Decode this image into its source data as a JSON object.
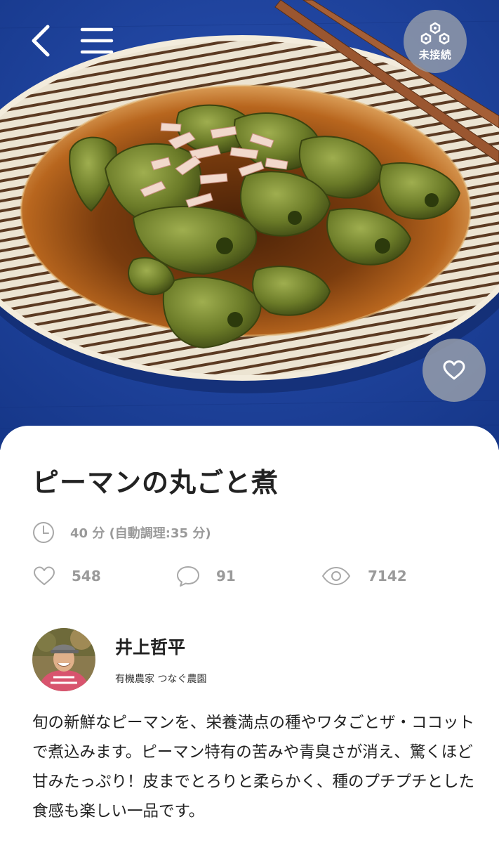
{
  "header": {
    "connect_label": "未接続",
    "icons": {
      "back": "chevron-left-icon",
      "menu": "hamburger-menu-icon",
      "connect": "hexagon-cluster-icon",
      "favorite": "heart-icon"
    }
  },
  "recipe": {
    "title": "ピーマンの丸ごと煮",
    "cook_time": "40 分 (自動調理:35 分)",
    "likes": "548",
    "comments": "91",
    "views": "7142",
    "description": "旬の新鮮なピーマンを、栄養満点の種やワタごとザ・ココットで煮込みます。ピーマン特有の苦みや青臭さが消え、驚くほど甘みたっぷり！皮までとろりと柔らかく、種のプチプチとした食感も楽しい一品です。"
  },
  "author": {
    "name": "井上哲平",
    "org": "有機農家 つなぐ農園"
  },
  "colors": {
    "tablecloth": "#1c3f9a",
    "plate": "#ece4d2",
    "broth": "#8a4712",
    "pepper": "#6f7f2c",
    "text_primary": "#222222",
    "text_muted": "#9a9a9a",
    "overlay_button": "#969eaa"
  }
}
